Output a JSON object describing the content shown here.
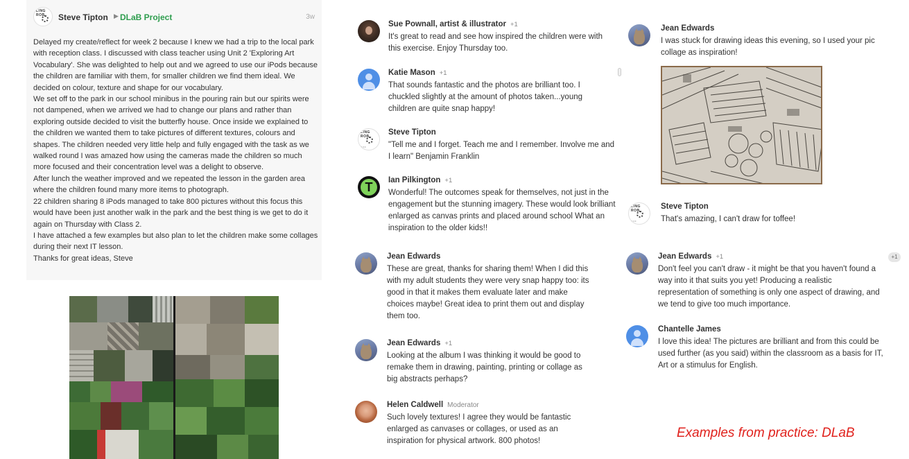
{
  "post": {
    "author": "Steve Tipton",
    "community": "DLaB Project",
    "time": "3w",
    "paragraphs": [
      "Delayed my create/reflect for week 2 because I knew we had a trip to the local park with reception class. I discussed with class teacher using Unit 2 'Exploring Art Vocabulary'. She was delighted to help out and we agreed to use our iPods because the children are familiar with them, for smaller children we find them ideal. We decided on colour, texture and shape for our vocabulary.",
      "We set off to the park in our school minibus in the pouring rain but our spirits were not dampened, when we arrived we had to change our plans and rather than exploring outside decided to visit the butterfly house. Once inside we explained to the children we wanted them to take pictures of different textures, colours and shapes. The children needed very little help and fully engaged with the task as we walked round I was amazed how using the cameras made the children so much more focused and their concentration level was a delight to observe.",
      "After lunch the weather improved and we repeated the lesson in the garden area where the children found many more items to photograph.",
      "22 children sharing 8 iPods managed to take 800 pictures without this focus this would have been just another walk in the park and the best thing is we get to do it again on Thursday with Class 2.",
      "I have attached a few examples but also plan to let the children make some collages during their next IT lesson.",
      "Thanks for great ideas, Steve"
    ]
  },
  "comments": [
    {
      "name": "Sue Pownall, artist & illustrator",
      "plus": "+1",
      "role": "",
      "avatar": "photo-portrait",
      "text": "It's great to read and see how inspired the children were with this exercise. Enjoy Thursday too."
    },
    {
      "name": "Katie Mason",
      "plus": "+1",
      "role": "",
      "avatar": "default-person-icon",
      "text": "That sounds fantastic and the photos are brilliant too. I chuckled slightly at the amount of photos taken...young children are quite snap happy!"
    },
    {
      "name": "Steve Tipton",
      "plus": "",
      "role": "",
      "avatar": "school-logo",
      "text": "\"Tell me and I forget. Teach me and I remember. Involve me and I learn\" Benjamin Franklin"
    },
    {
      "name": "Ian Pilkington",
      "plus": "+1",
      "role": "",
      "avatar": "letter-t",
      "text": "Wonderful! The outcomes speak for themselves, not just in the engagement but the stunning imagery. These would look brilliant enlarged as canvas prints and placed around school What an inspiration to the older kids!!"
    },
    {
      "name": "Jean Edwards",
      "plus": "",
      "role": "",
      "avatar": "cat-photo",
      "text": "These are great, thanks for sharing them! When I did this with my adult students they were very snap happy too: its good in that it makes them evaluate later and make choices maybe! Great idea to print them out and display them too."
    },
    {
      "name": "Jean Edwards",
      "plus": "+1",
      "role": "",
      "avatar": "cat-photo",
      "text": "Looking at the album I was thinking it would be good to remake them in drawing, painting, printing or collage as big abstracts perhaps?"
    },
    {
      "name": "Helen Caldwell",
      "plus": "",
      "role": "Moderator",
      "avatar": "photo-portrait",
      "text": "Such lovely textures! I agree they would be fantastic enlarged as canvases or collages, or used as an inspiration for physical artwork. 800 photos!"
    },
    {
      "name": "Jean Edwards",
      "plus": "",
      "role": "",
      "avatar": "cat-photo",
      "text": "I was stuck for drawing ideas this evening, so I used your pic collage as inspiration!"
    },
    {
      "name": "Steve Tipton",
      "plus": "",
      "role": "",
      "avatar": "school-logo",
      "text": "That's amazing, I can't draw for toffee!"
    },
    {
      "name": "Jean Edwards",
      "plus": "+1",
      "role": "",
      "avatar": "cat-photo",
      "text": "Don't feel you can't draw - it might be that you haven't found a way into it that suits you yet! Producing a realistic representation of something is only one aspect of drawing, and we tend to give too much importance."
    },
    {
      "name": "Chantelle James",
      "plus": "",
      "role": "",
      "avatar": "default-person-icon",
      "text": "I love this idea! The pictures are brilliant and from this could be used further (as you said) within the classroom as a basis for IT, Art or a stimulus for English."
    }
  ],
  "plus_chip": "+1",
  "logo_text": {
    "arc": "LING ROB",
    "dots": "• • •"
  },
  "caption": "Examples from practice: DLaB",
  "colors": {
    "community": "#2e9d4e",
    "caption": "#e0211c",
    "default_avatar": "#4f8fe6"
  }
}
